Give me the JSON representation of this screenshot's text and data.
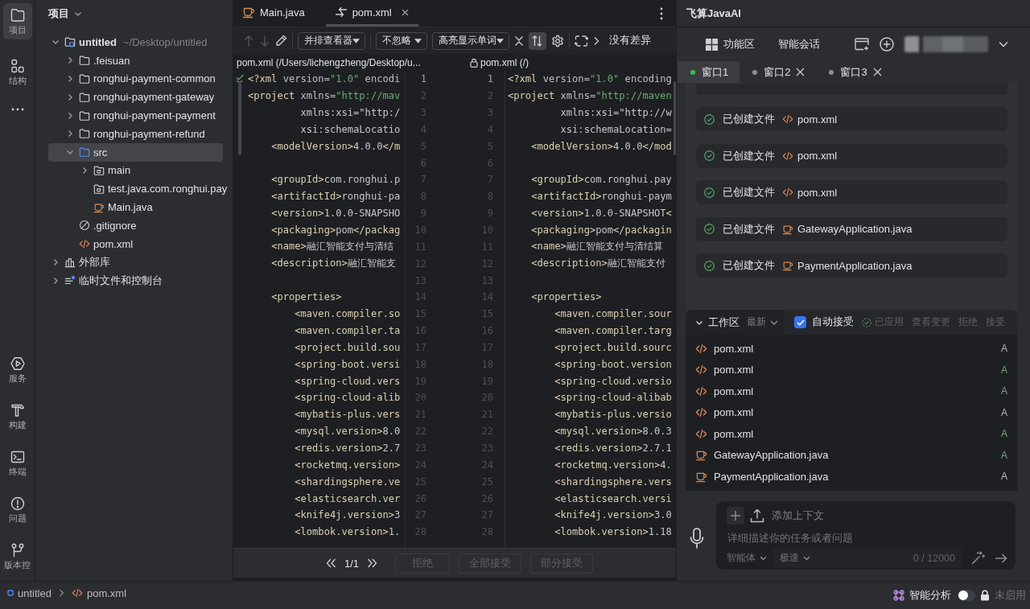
{
  "tool_strip": {
    "top": [
      {
        "kind": "project",
        "label": "项目",
        "selected": true
      },
      {
        "kind": "structure",
        "label": "结构",
        "selected": false
      }
    ],
    "bottom": [
      {
        "kind": "services",
        "label": "服务",
        "selected": false
      },
      {
        "kind": "build",
        "label": "构建",
        "selected": false
      },
      {
        "kind": "terminal",
        "label": "终端",
        "selected": false
      },
      {
        "kind": "problems",
        "label": "问题",
        "selected": false
      },
      {
        "kind": "vcs",
        "label": "版本控",
        "selected": false
      }
    ]
  },
  "project_panel": {
    "title": "项目",
    "items": [
      {
        "kind": "module",
        "label": "untitled",
        "path": "~/Desktop/untitled",
        "expanded": true,
        "selected": false,
        "children": [
          {
            "kind": "folder",
            "label": ".feisuan",
            "expanded": false,
            "selected": false
          },
          {
            "kind": "folder",
            "label": "ronghui-payment-common",
            "expanded": false,
            "selected": false
          },
          {
            "kind": "folder",
            "label": "ronghui-payment-gateway",
            "expanded": false,
            "selected": false
          },
          {
            "kind": "folder",
            "label": "ronghui-payment-payment",
            "expanded": false,
            "selected": false
          },
          {
            "kind": "folder",
            "label": "ronghui-payment-refund",
            "expanded": false,
            "selected": false
          },
          {
            "kind": "source",
            "label": "src",
            "expanded": true,
            "selected": true,
            "children": [
              {
                "kind": "package",
                "label": "main",
                "expanded": false,
                "selected": false
              },
              {
                "kind": "package",
                "label": "test.java.com.ronghui.pay",
                "selected": false
              },
              {
                "kind": "java",
                "label": "Main.java",
                "selected": false
              }
            ]
          },
          {
            "kind": "ignore",
            "label": ".gitignore",
            "selected": false
          },
          {
            "kind": "xml",
            "label": "pom.xml",
            "selected": false
          }
        ]
      },
      {
        "kind": "library",
        "label": "外部库",
        "expanded": false,
        "selected": false
      },
      {
        "kind": "scratch",
        "label": "临时文件和控制台",
        "expanded": false,
        "selected": false
      }
    ]
  },
  "editor": {
    "tabs": [
      {
        "kind": "java",
        "label": "Main.java",
        "selected": false,
        "close_button": false
      },
      {
        "kind": "diff",
        "label": "pom.xml",
        "selected": true,
        "close_button": true
      }
    ],
    "diff_toolbar": {
      "prev_disabled": true,
      "next_disabled": true,
      "viewer": "并排查看器",
      "ignore": "不忽略",
      "highlight": "高亮显示单词",
      "sync_scroll_on": true,
      "status": "没有差异"
    },
    "left_title": "pom.xml (/Users/lichengzheng/Desktop/u...",
    "right_title": "pom.xml (/)",
    "right_locked": true,
    "lines": [
      {
        "left_number": "1",
        "right_number": "1",
        "current": true,
        "left": "<?xml version=\"1.0\" encodi",
        "right": "<?xml version=\"1.0\" encoding"
      },
      {
        "left_number": "2",
        "right_number": "2",
        "current": false,
        "left": "<project xmlns=\"http://mav",
        "right": "<project xmlns=\"http://maven"
      },
      {
        "left_number": "3",
        "right_number": "3",
        "current": false,
        "left": "         xmlns:xsi=\"http:/",
        "right": "         xmlns:xsi=\"http://w"
      },
      {
        "left_number": "4",
        "right_number": "4",
        "current": false,
        "left": "         xsi:schemaLocatio",
        "right": "         xsi:schemaLocation="
      },
      {
        "left_number": "5",
        "right_number": "5",
        "current": false,
        "left": "    <modelVersion>4.0.0</m",
        "right": "    <modelVersion>4.0.0</mod"
      },
      {
        "left_number": "6",
        "right_number": "6",
        "current": false
      },
      {
        "left_number": "7",
        "right_number": "7",
        "current": false,
        "left": "    <groupId>com.ronghui.p",
        "right": "    <groupId>com.ronghui.pay"
      },
      {
        "left_number": "8",
        "right_number": "8",
        "current": false,
        "left": "    <artifactId>ronghui-pa",
        "right": "    <artifactId>ronghui-paym"
      },
      {
        "left_number": "9",
        "right_number": "9",
        "current": false,
        "left": "    <version>1.0.0-SNAPSHO",
        "right": "    <version>1.0.0-SNAPSHOT<"
      },
      {
        "left_number": "10",
        "right_number": "10",
        "current": false,
        "left": "    <packaging>pom</packag",
        "right": "    <packaging>pom</packagin"
      },
      {
        "left_number": "11",
        "right_number": "11",
        "current": false,
        "left": "    <name>融汇智能支付与清结",
        "right": "    <name>融汇智能支付与清结算"
      },
      {
        "left_number": "12",
        "right_number": "12",
        "current": false,
        "left": "    <description>融汇智能支",
        "right": "    <description>融汇智能支付"
      },
      {
        "left_number": "13",
        "right_number": "13",
        "current": false
      },
      {
        "left_number": "14",
        "right_number": "14",
        "current": false,
        "left": "    <properties>",
        "right": "    <properties>"
      },
      {
        "left_number": "15",
        "right_number": "15",
        "current": false,
        "left": "        <maven.compiler.so",
        "right": "        <maven.compiler.sour"
      },
      {
        "left_number": "16",
        "right_number": "16",
        "current": false,
        "left": "        <maven.compiler.ta",
        "right": "        <maven.compiler.targ"
      },
      {
        "left_number": "17",
        "right_number": "17",
        "current": false,
        "left": "        <project.build.sou",
        "right": "        <project.build.sourc"
      },
      {
        "left_number": "18",
        "right_number": "18",
        "current": false,
        "left": "        <spring-boot.versi",
        "right": "        <spring-boot.version"
      },
      {
        "left_number": "19",
        "right_number": "19",
        "current": false,
        "left": "        <spring-cloud.vers",
        "right": "        <spring-cloud.versio"
      },
      {
        "left_number": "20",
        "right_number": "20",
        "current": false,
        "left": "        <spring-cloud-alib",
        "right": "        <spring-cloud-alibab"
      },
      {
        "left_number": "21",
        "right_number": "21",
        "current": false,
        "left": "        <mybatis-plus.vers",
        "right": "        <mybatis-plus.versio"
      },
      {
        "left_number": "22",
        "right_number": "22",
        "current": false,
        "left": "        <mysql.version>8.0",
        "right": "        <mysql.version>8.0.3"
      },
      {
        "left_number": "23",
        "right_number": "23",
        "current": false,
        "left": "        <redis.version>2.7",
        "right": "        <redis.version>2.7.1"
      },
      {
        "left_number": "24",
        "right_number": "24",
        "current": false,
        "left": "        <rocketmq.version>",
        "right": "        <rocketmq.version>4."
      },
      {
        "left_number": "25",
        "right_number": "25",
        "current": false,
        "left": "        <shardingsphere.ve",
        "right": "        <shardingsphere.vers"
      },
      {
        "left_number": "26",
        "right_number": "26",
        "current": false,
        "left": "        <elasticsearch.ver",
        "right": "        <elasticsearch.versi"
      },
      {
        "left_number": "27",
        "right_number": "27",
        "current": false,
        "left": "        <knife4j.version>3",
        "right": "        <knife4j.version>3.0"
      },
      {
        "left_number": "28",
        "right_number": "28",
        "current": false,
        "left": "        <lombok.version>1.",
        "right": "        <lombok.version>1.18"
      }
    ],
    "counter": "1/1",
    "actions": [
      {
        "label": "拒绝",
        "disabled": true
      },
      {
        "label": "全部接受",
        "disabled": true
      },
      {
        "label": "部分接受",
        "disabled": true
      }
    ]
  },
  "ai_panel": {
    "title": "飞算JavaAI",
    "nav": [
      {
        "kind": "grid",
        "label": "功能区"
      },
      {
        "kind": "text",
        "label": "智能会话"
      }
    ],
    "windows": [
      {
        "label": "窗口1",
        "selected": true,
        "color": "#3fb950",
        "close_button": false
      },
      {
        "label": "窗口2",
        "selected": false,
        "color": "#8b8e94",
        "close_button": true
      },
      {
        "label": "窗口3",
        "selected": false,
        "color": "#8b8e94",
        "close_button": true
      }
    ],
    "messages": [
      {
        "text": "已创建文件",
        "kind": "xml",
        "file": "pom.xml"
      },
      {
        "text": "已创建文件",
        "kind": "xml",
        "file": "pom.xml"
      },
      {
        "text": "已创建文件",
        "kind": "xml",
        "file": "pom.xml"
      },
      {
        "text": "已创建文件",
        "kind": "java",
        "file": "GatewayApplication.java"
      },
      {
        "text": "已创建文件",
        "kind": "java",
        "file": "PaymentApplication.java"
      }
    ],
    "workspace": {
      "expanded": true,
      "title": "工作区",
      "sort": "最新",
      "auto_accept": {
        "label": "自动接受",
        "checked": true
      },
      "applied": "已应用",
      "actions": [
        {
          "label": "查看变更",
          "disabled": true
        },
        {
          "label": "拒绝",
          "disabled": true
        },
        {
          "label": "接受",
          "disabled": true
        }
      ],
      "files": [
        {
          "kind": "xml",
          "name": "pom.xml",
          "status": "A",
          "color": "#b4b7bd"
        },
        {
          "kind": "xml",
          "name": "pom.xml",
          "status": "A",
          "color": "#6aab73"
        },
        {
          "kind": "xml",
          "name": "pom.xml",
          "status": "A",
          "color": "#6aab73"
        },
        {
          "kind": "xml",
          "name": "pom.xml",
          "status": "A",
          "color": "#b4b7bd"
        },
        {
          "kind": "xml",
          "name": "pom.xml",
          "status": "A",
          "color": "#6aab73"
        },
        {
          "kind": "java",
          "name": "GatewayApplication.java",
          "status": "A",
          "color": "#6aab73"
        },
        {
          "kind": "java",
          "name": "PaymentApplication.java",
          "status": "A",
          "color": "#b4b7bd"
        }
      ]
    },
    "composer": {
      "add_context": "添加上下文",
      "placeholder": "详细描述你的任务或者问题",
      "mode": "智能体",
      "speed": "极速",
      "count": "0 / 12000"
    }
  },
  "status_bar": {
    "breadcrumb": [
      {
        "kind": "module",
        "label": "untitled"
      },
      {
        "kind": "xml",
        "label": "pom.xml"
      }
    ],
    "analysis_label": "智能分析",
    "analysis_on": false,
    "locked": true,
    "analysis_state": "未启用"
  }
}
